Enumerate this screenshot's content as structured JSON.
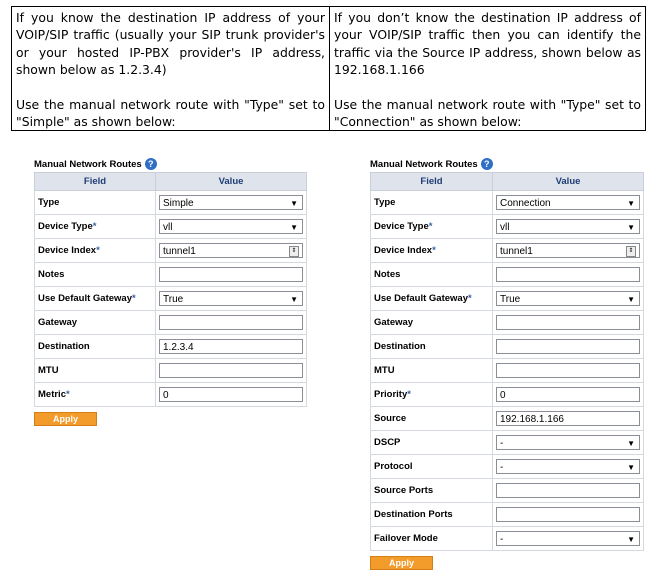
{
  "intro": {
    "left": {
      "paragraph1": "If you know the destination IP address of your VOIP/SIP traffic (usually your SIP trunk provider's or your hosted IP-PBX provider's IP address, shown below as 1.2.3.4)",
      "paragraph2": "Use the manual network route with \"Type\" set to \"Simple\" as shown below:"
    },
    "right": {
      "paragraph1": "If you don’t know the destination IP address of your VOIP/SIP traffic then you can identify the traffic via the Source IP address, shown below as 192.168.1.166",
      "paragraph2": "Use the manual network route with \"Type\" set to \"Connection\" as shown below:"
    }
  },
  "left_panel": {
    "title": "Manual Network Routes",
    "help_icon": "?",
    "header_field": "Field",
    "header_value": "Value",
    "apply_label": "Apply",
    "rows": [
      {
        "label": "Type",
        "req": "",
        "value": "Simple",
        "kind": "select"
      },
      {
        "label": "Device Type",
        "req": "*",
        "value": "vll",
        "kind": "select"
      },
      {
        "label": "Device Index",
        "req": "*",
        "value": "tunnel1",
        "kind": "spin"
      },
      {
        "label": "Notes",
        "req": "",
        "value": "",
        "kind": "text"
      },
      {
        "label": "Use Default Gateway",
        "req": "*",
        "value": "True",
        "kind": "select"
      },
      {
        "label": "Gateway",
        "req": "",
        "value": "",
        "kind": "text"
      },
      {
        "label": "Destination",
        "req": "",
        "value": "1.2.3.4",
        "kind": "text"
      },
      {
        "label": "MTU",
        "req": "",
        "value": "",
        "kind": "text"
      },
      {
        "label": "Metric",
        "req": "*",
        "value": "0",
        "kind": "text"
      }
    ]
  },
  "right_panel": {
    "title": "Manual Network Routes",
    "help_icon": "?",
    "header_field": "Field",
    "header_value": "Value",
    "apply_label": "Apply",
    "rows": [
      {
        "label": "Type",
        "req": "",
        "value": "Connection",
        "kind": "select"
      },
      {
        "label": "Device Type",
        "req": "*",
        "value": "vll",
        "kind": "select"
      },
      {
        "label": "Device Index",
        "req": "*",
        "value": "tunnel1",
        "kind": "spin"
      },
      {
        "label": "Notes",
        "req": "",
        "value": "",
        "kind": "text"
      },
      {
        "label": "Use Default Gateway",
        "req": "*",
        "value": "True",
        "kind": "select"
      },
      {
        "label": "Gateway",
        "req": "",
        "value": "",
        "kind": "text"
      },
      {
        "label": "Destination",
        "req": "",
        "value": "",
        "kind": "text"
      },
      {
        "label": "MTU",
        "req": "",
        "value": "",
        "kind": "text"
      },
      {
        "label": "Priority",
        "req": "*",
        "value": "0",
        "kind": "text"
      },
      {
        "label": "Source",
        "req": "",
        "value": "192.168.1.166",
        "kind": "text"
      },
      {
        "label": "DSCP",
        "req": "",
        "value": "-",
        "kind": "select"
      },
      {
        "label": "Protocol",
        "req": "",
        "value": "-",
        "kind": "select"
      },
      {
        "label": "Source Ports",
        "req": "",
        "value": "",
        "kind": "text"
      },
      {
        "label": "Destination Ports",
        "req": "",
        "value": "",
        "kind": "text"
      },
      {
        "label": "Failover Mode",
        "req": "",
        "value": "-",
        "kind": "select"
      }
    ]
  }
}
